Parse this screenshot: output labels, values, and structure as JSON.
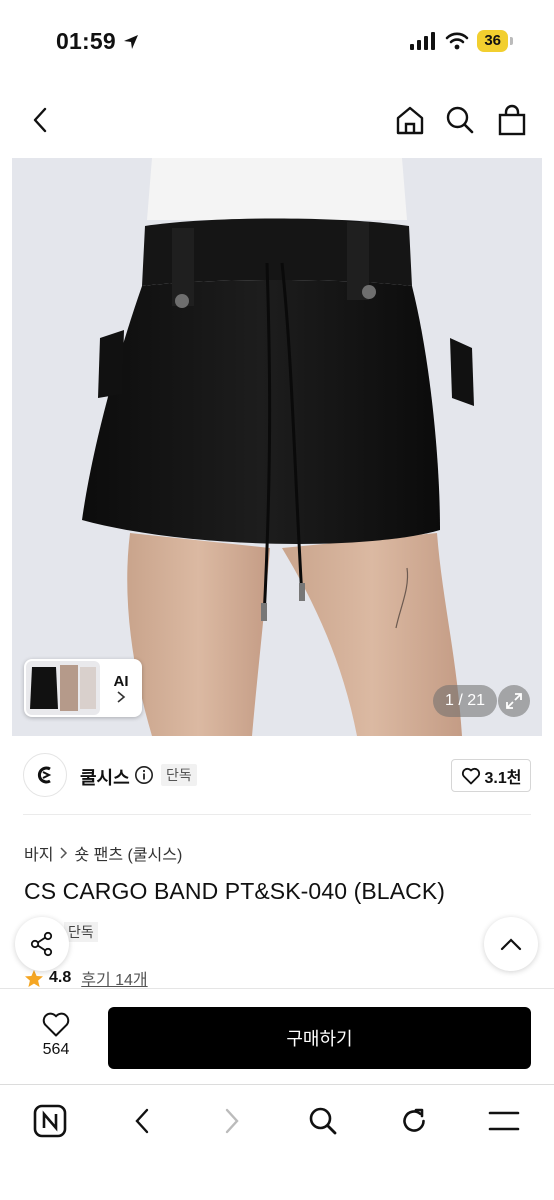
{
  "status_bar": {
    "time": "01:59",
    "battery": "36"
  },
  "header": {
    "icons": [
      "back-icon",
      "home-icon",
      "search-icon",
      "shopping-bag-icon"
    ]
  },
  "gallery": {
    "thumb_label": "AI",
    "counter": "1 / 21"
  },
  "brand": {
    "name": "쿨시스",
    "badge": "단독",
    "likes": "3.1천"
  },
  "breadcrumb": {
    "category": "바지",
    "subcategory": "숏 팬츠 (쿨시스)"
  },
  "product": {
    "title": "CS CARGO BAND PT&SK-040 (BLACK)",
    "tag": "단독",
    "rating": "4.8",
    "reviews": "후기 14개"
  },
  "purchase": {
    "wish_count": "564",
    "buy_label": "구매하기"
  },
  "browser_toolbar": {
    "icons": [
      "naver-icon",
      "back-icon",
      "forward-icon",
      "search-icon",
      "refresh-icon",
      "menu-icon"
    ]
  },
  "colors": {
    "buy_button": "#000000",
    "battery": "#F2CF2F",
    "star": "#F5A623"
  }
}
